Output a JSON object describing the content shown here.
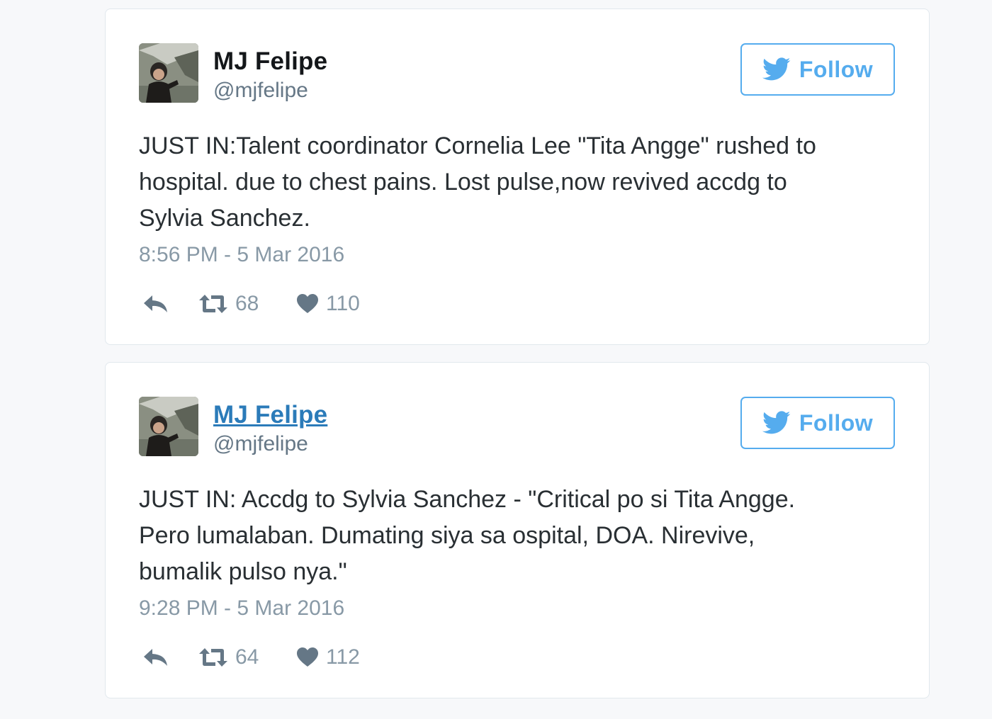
{
  "tweets": [
    {
      "author_name": "MJ Felipe",
      "author_handle": "@mjfelipe",
      "follow_label": "Follow",
      "text_lines": [
        "JUST IN:Talent coordinator Cornelia Lee \"Tita Angge\" rushed to",
        "hospital. due to chest pains. Lost pulse,now revived accdg to",
        "Sylvia Sanchez."
      ],
      "timestamp": "8:56 PM - 5 Mar 2016",
      "retweets": "68",
      "likes": "110"
    },
    {
      "author_name": "MJ Felipe",
      "author_handle": "@mjfelipe",
      "follow_label": "Follow",
      "text_lines": [
        "JUST IN: Accdg to Sylvia Sanchez - \"Critical po si Tita Angge.",
        "Pero lumalaban. Dumating siya sa ospital, DOA. Nirevive,",
        "bumalik pulso nya.\""
      ],
      "timestamp": "9:28 PM - 5 Mar 2016",
      "retweets": "64",
      "likes": "112"
    }
  ],
  "icons": {
    "follow": "twitter-bird-icon",
    "reply": "reply-icon",
    "retweet": "retweet-icon",
    "like": "heart-icon"
  },
  "colors": {
    "twitter_blue": "#55acee",
    "link_blue": "#2b7bb9",
    "text": "#292f33",
    "muted": "#8899a6"
  }
}
